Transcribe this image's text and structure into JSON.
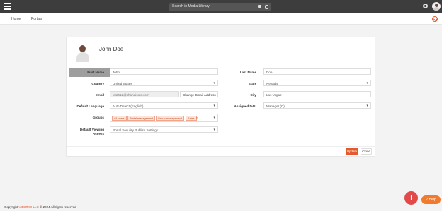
{
  "topbar": {
    "search_placeholder": "Search in Media Library"
  },
  "subnav": {
    "home": "Home",
    "portals": "Portals"
  },
  "profile": {
    "name": "John Doe"
  },
  "form": {
    "left": [
      {
        "label": "First Name",
        "value": "John"
      },
      {
        "label": "Country",
        "value": "United States"
      },
      {
        "label": "Email",
        "value": "test612@shahaisolo.com"
      },
      {
        "label": "Default Language",
        "value": "Auto Detect (English)"
      },
      {
        "label": "Groups"
      },
      {
        "label": "Default Viewing",
        "label2": "Access",
        "value": "Portal Security Publish Settings"
      }
    ],
    "change_email_label": "Change Email Address",
    "groups": [
      "All users",
      "Portal management",
      "Group management",
      "Sales"
    ],
    "right": [
      {
        "label": "Last Name",
        "value": "Doe"
      },
      {
        "label": "State",
        "value": "Nevada"
      },
      {
        "label": "City",
        "value": "Las Vegas"
      },
      {
        "label": "Assigned DAL",
        "value": "Manager (C)"
      }
    ]
  },
  "actions": {
    "update": "Update",
    "close": "Close"
  },
  "help_label": "Help",
  "fab_label": "+",
  "footer": {
    "prefix": "Copyright",
    "brand": "VIDIZMO LLC",
    "suffix": "© 2024 All rights reserved"
  },
  "colors": {
    "accent": "#e35a2c",
    "topbar": "#3d3d3d",
    "fab": "#e24a4a",
    "help": "#f07a2e"
  }
}
